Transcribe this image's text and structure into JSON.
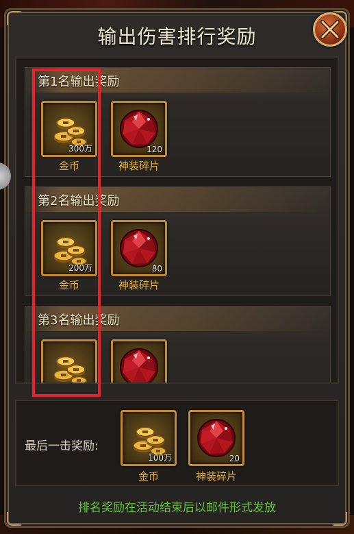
{
  "dialog": {
    "title": "输出伤害排行奖励",
    "footer_note": "排名奖励在活动结束后以邮件形式发放"
  },
  "tiers": [
    {
      "heading": "第1名输出奖励",
      "items": [
        {
          "icon": "gold-coins-icon",
          "qty": "300万",
          "label": "金币"
        },
        {
          "icon": "red-gem-fragment-icon",
          "qty": "120",
          "label": "神装碎片"
        }
      ]
    },
    {
      "heading": "第2名输出奖励",
      "items": [
        {
          "icon": "gold-coins-icon",
          "qty": "200万",
          "label": "金币"
        },
        {
          "icon": "red-gem-fragment-icon",
          "qty": "80",
          "label": "神装碎片"
        }
      ]
    },
    {
      "heading": "第3名输出奖励",
      "items": [
        {
          "icon": "gold-coins-icon",
          "qty": "",
          "label": ""
        },
        {
          "icon": "red-gem-fragment-icon",
          "qty": "",
          "label": ""
        }
      ]
    }
  ],
  "last_hit": {
    "label": "最后一击奖励:",
    "items": [
      {
        "icon": "gold-coins-icon",
        "qty": "100万",
        "label": "金币"
      },
      {
        "icon": "red-gem-fragment-icon",
        "qty": "20",
        "label": "神装碎片"
      }
    ]
  },
  "colors": {
    "accent_gold": "#e8b23c",
    "highlight_red": "#e8222a",
    "footer_green": "#62c23a"
  }
}
